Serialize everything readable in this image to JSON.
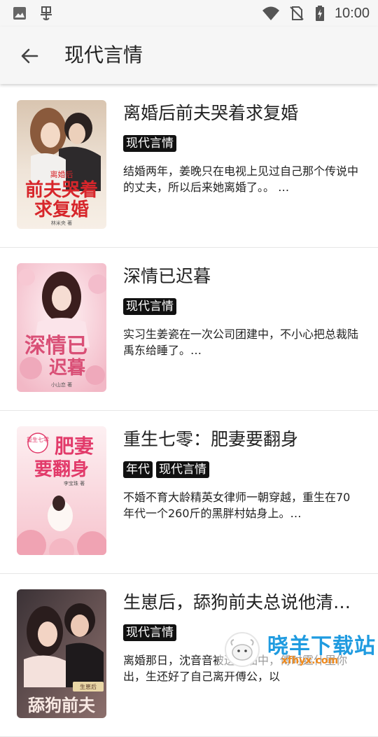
{
  "status_bar": {
    "time": "10:00",
    "icons": [
      "image-icon",
      "bug-icon",
      "wifi-icon",
      "no-sim-icon",
      "battery-charging-icon"
    ]
  },
  "app_bar": {
    "title": "现代言情",
    "back_icon": "arrow-left-icon"
  },
  "books": [
    {
      "title": "离婚后前夫哭着求复婚",
      "tags": [
        "现代言情"
      ],
      "description": "结婚两年，姜晚只在电视上见过自己那个传说中的丈夫，所以后来她离婚了。。 …",
      "cover": {
        "line1": "离婚后",
        "line2": "前夫哭着",
        "line3": "求复婚",
        "author": "林米央 著",
        "colors": [
          "#e9dccd",
          "#c7a27c",
          "#d7262b"
        ]
      }
    },
    {
      "title": "深情已迟暮",
      "tags": [
        "现代言情"
      ],
      "description": "实习生姜瓷在一次公司团建中，不小心把总裁陆禹东给睡了。…",
      "cover": {
        "line1": "深情已",
        "line2": "迟暮",
        "author": "小山恋 著",
        "colors": [
          "#f6d9df",
          "#e89aae",
          "#e0567a"
        ]
      }
    },
    {
      "title": "重生七零：肥妻要翻身",
      "tags": [
        "年代",
        "现代言情"
      ],
      "description": "不婚不育大龄精英女律师一朝穿越，重生在70年代一个260斤的黑胖村姑身上。…",
      "cover": {
        "line1": "重生七零",
        "line2": "肥妻",
        "line3": "要翻身",
        "author": "李宝珠 著",
        "colors": [
          "#fbe9ec",
          "#f3b9c3",
          "#e23a6a"
        ]
      }
    },
    {
      "title": "生崽后，舔狗前夫总说他清…",
      "tags": [
        "现代言情"
      ],
      "description": "离婚那日，沈音音被送进油中，傅时霆什里你出，生还好了自己离开傅公，以",
      "cover": {
        "line1": "生崽后",
        "line2": "舔狗前夫",
        "colors": [
          "#5a4a4a",
          "#caa6a0",
          "#f4e1dc"
        ]
      }
    }
  ],
  "watermark": {
    "text": "晓羊下载站",
    "url": "xfhyx.com"
  }
}
